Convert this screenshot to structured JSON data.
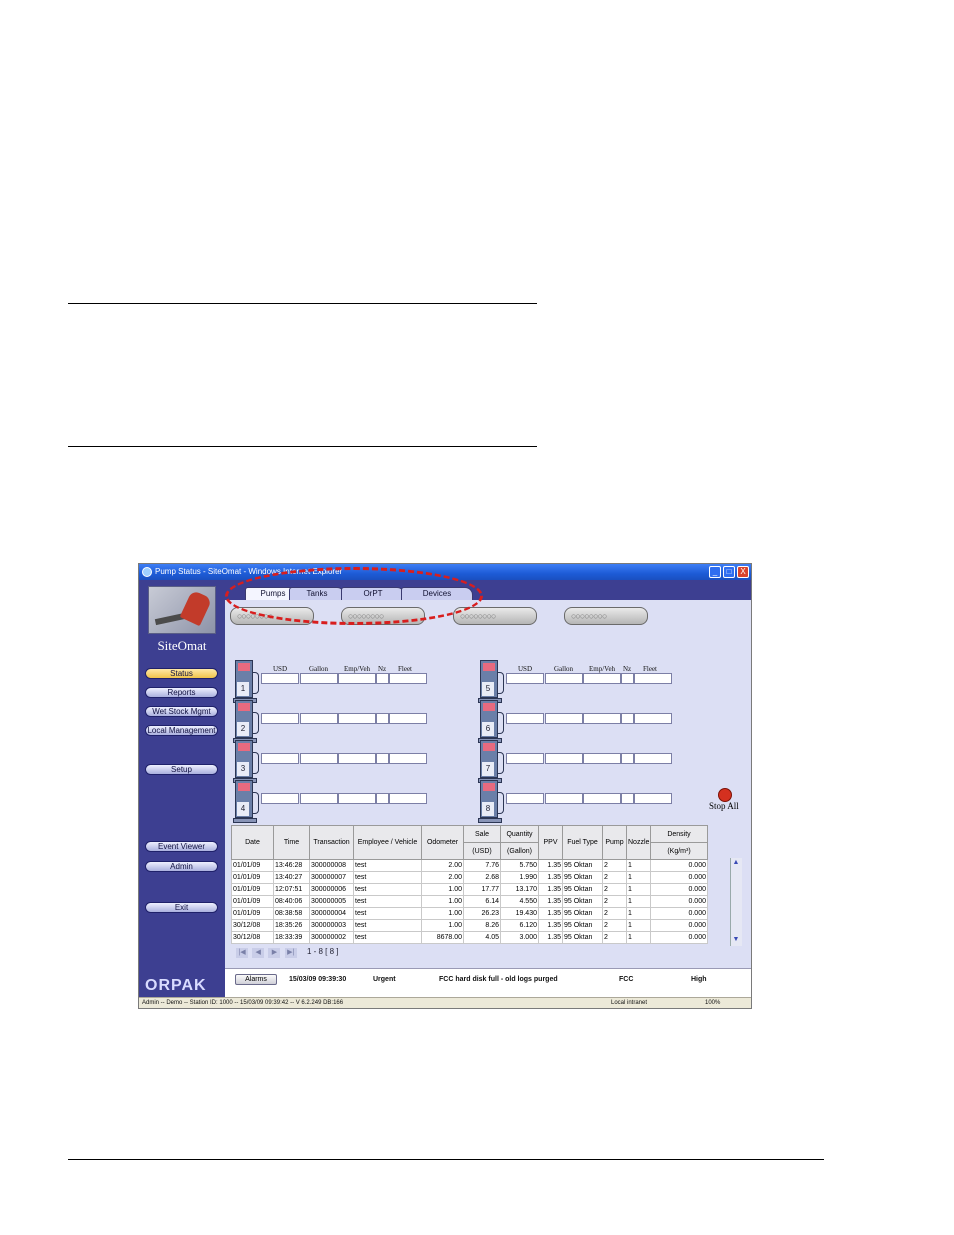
{
  "window": {
    "title": "Pump Status - SiteOmat - Windows Internet Explorer",
    "min_btn": "_",
    "max_btn": "□",
    "close_btn": "X"
  },
  "sidebar": {
    "logo_text": "SiteOmat",
    "items": [
      {
        "label": "Status"
      },
      {
        "label": "Reports"
      },
      {
        "label": "Wet Stock Mgmt"
      },
      {
        "label": "Local Management"
      },
      {
        "label": "Setup"
      },
      {
        "label": "Event Viewer"
      },
      {
        "label": "Admin"
      },
      {
        "label": "Exit"
      }
    ],
    "brand": "ORPAK"
  },
  "tabs": [
    {
      "label": "Pumps"
    },
    {
      "label": "Tanks"
    },
    {
      "label": "OrPT"
    },
    {
      "label": "Devices"
    }
  ],
  "pump_groups": [
    "○○○○○○○○",
    "○○○○○○○○",
    "○○○○○○○○",
    "○○○○○○○○"
  ],
  "pump_headers": {
    "usd": "USD",
    "gallon": "Gallon",
    "emp": "Emp/Veh",
    "nz": "Nz",
    "fleet": "Fleet"
  },
  "pumps": [
    {
      "number": "1"
    },
    {
      "number": "2"
    },
    {
      "number": "3"
    },
    {
      "number": "4"
    },
    {
      "number": "5"
    },
    {
      "number": "6"
    },
    {
      "number": "7"
    },
    {
      "number": "8"
    }
  ],
  "stop_all": "Stop All",
  "transactions": {
    "headers": {
      "date": "Date",
      "time": "Time",
      "transaction": "Transaction",
      "employee": "Employee / Vehicle",
      "odometer": "Odometer",
      "sale": "Sale",
      "sale_unit": "(USD)",
      "quantity": "Quantity",
      "quantity_unit": "(Gallon)",
      "ppv": "PPV",
      "fuel": "Fuel Type",
      "pump": "Pump",
      "nozzle": "Nozzle",
      "density": "Density",
      "density_unit": "(Kg/m³)"
    },
    "rows": [
      {
        "date": "01/01/09",
        "time": "13:46:28",
        "transaction": "300000008",
        "employee": "test",
        "odometer": "2.00",
        "sale": "7.76",
        "quantity": "5.750",
        "ppv": "1.35",
        "fuel": "95 Oktan",
        "pump": "2",
        "nozzle": "1",
        "density": "0.000"
      },
      {
        "date": "01/01/09",
        "time": "13:40:27",
        "transaction": "300000007",
        "employee": "test",
        "odometer": "2.00",
        "sale": "2.68",
        "quantity": "1.990",
        "ppv": "1.35",
        "fuel": "95 Oktan",
        "pump": "2",
        "nozzle": "1",
        "density": "0.000"
      },
      {
        "date": "01/01/09",
        "time": "12:07:51",
        "transaction": "300000006",
        "employee": "test",
        "odometer": "1.00",
        "sale": "17.77",
        "quantity": "13.170",
        "ppv": "1.35",
        "fuel": "95 Oktan",
        "pump": "2",
        "nozzle": "1",
        "density": "0.000"
      },
      {
        "date": "01/01/09",
        "time": "08:40:06",
        "transaction": "300000005",
        "employee": "test",
        "odometer": "1.00",
        "sale": "6.14",
        "quantity": "4.550",
        "ppv": "1.35",
        "fuel": "95 Oktan",
        "pump": "2",
        "nozzle": "1",
        "density": "0.000"
      },
      {
        "date": "01/01/09",
        "time": "08:38:58",
        "transaction": "300000004",
        "employee": "test",
        "odometer": "1.00",
        "sale": "26.23",
        "quantity": "19.430",
        "ppv": "1.35",
        "fuel": "95 Oktan",
        "pump": "2",
        "nozzle": "1",
        "density": "0.000"
      },
      {
        "date": "30/12/08",
        "time": "18:35:26",
        "transaction": "300000003",
        "employee": "test",
        "odometer": "1.00",
        "sale": "8.26",
        "quantity": "6.120",
        "ppv": "1.35",
        "fuel": "95 Oktan",
        "pump": "2",
        "nozzle": "1",
        "density": "0.000"
      },
      {
        "date": "30/12/08",
        "time": "18:33:39",
        "transaction": "300000002",
        "employee": "test",
        "odometer": "8678.00",
        "sale": "4.05",
        "quantity": "3.000",
        "ppv": "1.35",
        "fuel": "95 Oktan",
        "pump": "2",
        "nozzle": "1",
        "density": "0.000"
      }
    ],
    "pager": {
      "first": "|◀",
      "prev": "◀",
      "next": "▶",
      "last": "▶|",
      "range": "1 - 8  [ 8 ]"
    }
  },
  "alarm": {
    "button": "Alarms",
    "datetime": "15/03/09 09:39:30",
    "severity": "Urgent",
    "message": "FCC hard disk full - old logs purged",
    "source": "FCC",
    "level": "High"
  },
  "statusbar": {
    "text": "Admin -- Demo -- Station ID: 1000 -- 15/03/09  09:39:42 -- V 6.2.249 DB:166",
    "zone": "Local intranet",
    "zoom": "100%"
  },
  "colors": {
    "sidebar": "#3d3f91",
    "highlight": "#d81e1e",
    "titlebar": "#1d5bd6"
  }
}
